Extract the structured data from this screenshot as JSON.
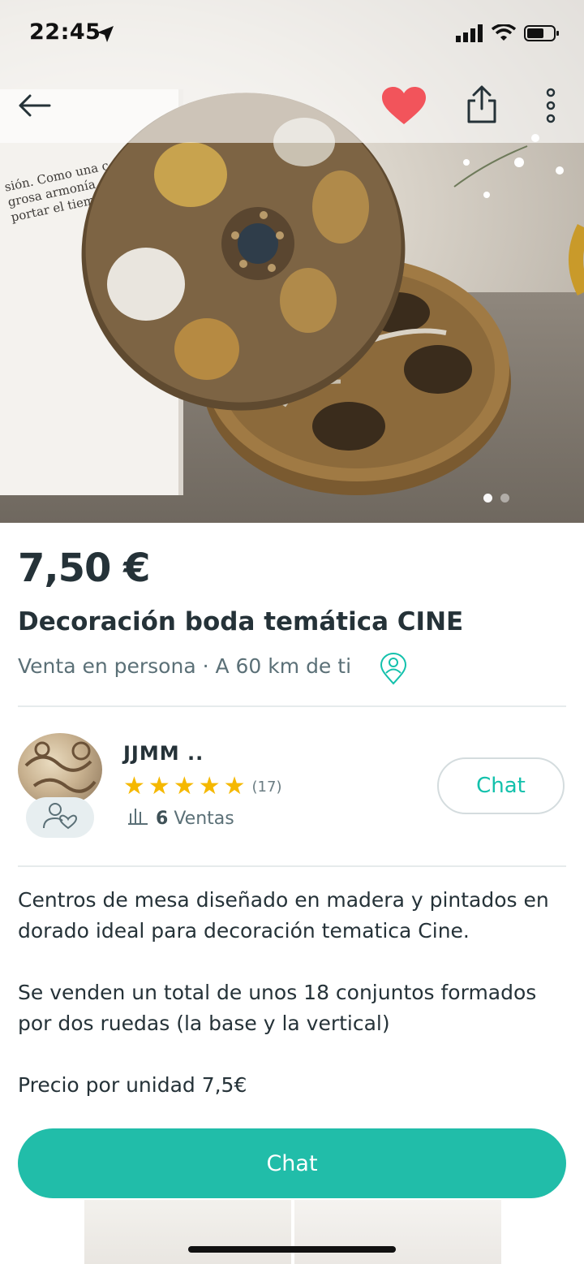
{
  "status_bar": {
    "time": "22:45"
  },
  "hero": {
    "frame_text": [
      "sión. Como una c",
      "grosa armonía",
      "portar el tiem"
    ],
    "pagination": {
      "current": 1,
      "total": 2
    }
  },
  "product": {
    "price": "7,50 €",
    "title": "Decoración boda temática CINE",
    "delivery": "Venta en persona · A 60 km de ti"
  },
  "seller": {
    "name": "JJMM ..",
    "rating_stars": 5,
    "reviews": "(17)",
    "sales_count": "6",
    "sales_label": "Ventas",
    "chat_label": "Chat"
  },
  "description": [
    "Centros de mesa diseñado en madera y pintados en dorado ideal para decoración tematica Cine.",
    "Se venden un total de unos 18 conjuntos formados por dos ruedas (la base y la vertical)",
    "Precio por unidad 7,5€"
  ],
  "footer": {
    "chat_label": "Chat"
  },
  "colors": {
    "accent": "#13c1ac",
    "button_bg": "#21bda9",
    "heart": "#f2545b",
    "star": "#f5b800",
    "text": "#253238"
  }
}
